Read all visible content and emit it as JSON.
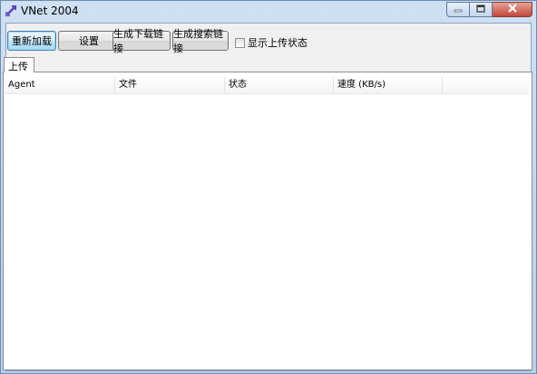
{
  "window": {
    "title": "VNet 2004"
  },
  "toolbar": {
    "reload_label": "重新加载",
    "settings_label": "设置",
    "gen_download_link_label": "生成下载链接",
    "gen_search_link_label": "生成搜索链接",
    "show_upload_status_label": "显示上传状态",
    "show_upload_status_checked": false
  },
  "tabs": [
    {
      "label": "上传"
    }
  ],
  "table": {
    "columns": [
      {
        "label": "Agent"
      },
      {
        "label": "文件"
      },
      {
        "label": "状态"
      },
      {
        "label": "速度 (KB/s)"
      }
    ],
    "rows": []
  },
  "colors": {
    "accent": "#3c7fb1",
    "close_button": "#c1483a"
  }
}
